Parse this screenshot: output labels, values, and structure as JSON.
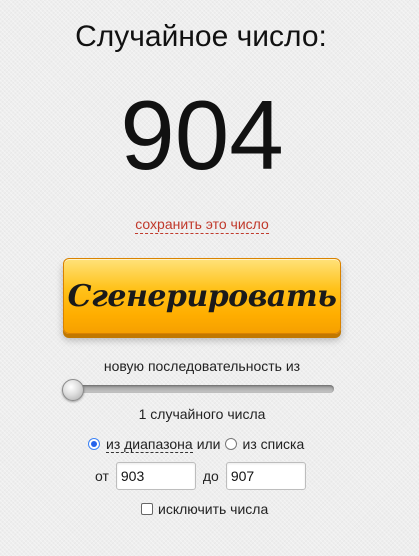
{
  "title": "Случайное число:",
  "result": "904",
  "save_link": "сохранить это число",
  "generate_button": "Сгенерировать",
  "sequence": {
    "label": "новую последовательность из",
    "count_label": "1 случайного числа",
    "slider_value": 1
  },
  "mode": {
    "range_label": "из диапазона",
    "or_label": "или",
    "list_label": "из списка",
    "selected": "range"
  },
  "range": {
    "from_label": "от",
    "from_value": "903",
    "to_label": "до",
    "to_value": "907"
  },
  "exclude_label": "исключить числа",
  "colors": {
    "button": "#ffb300",
    "link": "#c0392b",
    "radio_selected": "#2563eb"
  }
}
